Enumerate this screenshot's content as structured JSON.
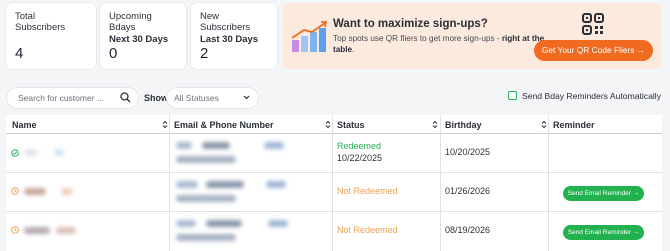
{
  "stats": [
    {
      "label": "Total Subscribers",
      "sublabel": "",
      "value": "4"
    },
    {
      "label": "Upcoming Bdays",
      "sublabel": "Next 30 Days",
      "value": "0"
    },
    {
      "label": "New Subscribers",
      "sublabel": "Last 30 Days",
      "value": "2"
    }
  ],
  "promo": {
    "title": "Want to maximize sign-ups?",
    "desc_prefix": "Top spots use QR fliers to get more sign-ups - ",
    "desc_bold": "right at the table",
    "desc_suffix": ".",
    "button": "Get Your QR Code Fliers →"
  },
  "filters": {
    "search_placeholder": "Search for customer ...",
    "show_label": "Show",
    "status_value": "All Statuses",
    "bday_checkbox_label": "Send Bday Reminders Automatically",
    "bday_checked": false
  },
  "table": {
    "headers": [
      "Name",
      "Email & Phone Number",
      "Status",
      "Birthday",
      "Reminder"
    ],
    "rows": [
      {
        "status": "Redeemed",
        "status_date": "10/22/2025",
        "birthday": "10/20/2025",
        "reminder": ""
      },
      {
        "status": "Not Redeemed",
        "status_date": "",
        "birthday": "01/26/2026",
        "reminder": "Send Email Reminder →"
      },
      {
        "status": "Not Redeemed",
        "status_date": "",
        "birthday": "08/19/2026",
        "reminder": "Send Email Reminder →"
      }
    ]
  },
  "colors": {
    "accent_orange": "#f06b1f",
    "green": "#22b14f",
    "not_redeemed": "#f0a152",
    "promo_bg": "#fdeadf"
  },
  "icons": {
    "search": "search-icon",
    "chevron": "chevron-down-icon",
    "sort": "sort-icon",
    "check_circle": "check-circle-icon",
    "clock_circle": "clock-icon",
    "qr": "qr-code-icon",
    "growth_chart": "growth-chart-icon"
  }
}
